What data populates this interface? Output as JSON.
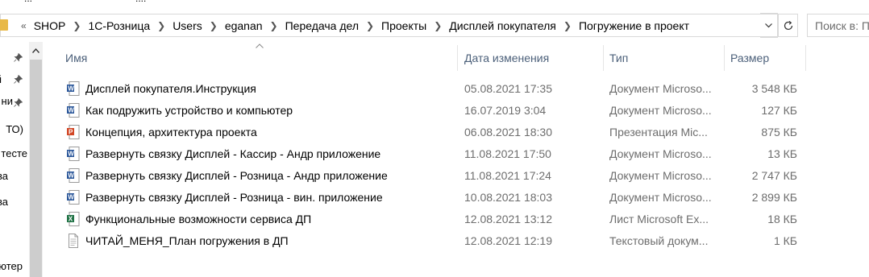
{
  "topstrip": {
    "left_text": "...",
    "right_text": "...."
  },
  "address": {
    "overflow_chevron": "«",
    "crumbs": [
      "SHOP",
      "1С-Розница",
      "Users",
      "eganan",
      "Передача дел",
      "Проекты",
      "Дисплей покупателя",
      "Погружение в проект"
    ],
    "separator": ">"
  },
  "search": {
    "placeholder": "Поиск в: П"
  },
  "nav": {
    "items": [
      {
        "label": "",
        "pinned": true
      },
      {
        "label": "й",
        "pinned": true
      },
      {
        "label": "ни",
        "pinned": true
      },
      {
        "label": "ТО)",
        "pinned": false
      },
      {
        "label": "тесте",
        "pinned": false
      },
      {
        "label": "ва",
        "pinned": false
      },
      {
        "label": "ва",
        "pinned": false
      },
      {
        "label": "",
        "pinned": false
      },
      {
        "label": "",
        "pinned": false
      },
      {
        "label": "ютер",
        "pinned": false
      }
    ]
  },
  "columns": {
    "name": "Имя",
    "date": "Дата изменения",
    "type": "Тип",
    "size": "Размер"
  },
  "files": [
    {
      "icon": "word-doc-icon",
      "name": "Дисплей покупателя.Инструкция",
      "date": "05.08.2021 17:35",
      "type": "Документ Microso...",
      "size": "3 548 КБ"
    },
    {
      "icon": "word-doc-icon",
      "name": "Как подружить устройство и компьютер",
      "date": "16.07.2019 3:04",
      "type": "Документ Microso...",
      "size": "127 КБ"
    },
    {
      "icon": "powerpoint-icon",
      "name": "Концепция, архитектура проекта",
      "date": "06.08.2021 18:30",
      "type": "Презентация Mic...",
      "size": "875 КБ"
    },
    {
      "icon": "word-doc-icon",
      "name": "Развернуть связку Дисплей - Кассир - Андр приложение",
      "date": "11.08.2021 17:50",
      "type": "Документ Microso...",
      "size": "13 КБ"
    },
    {
      "icon": "word-doc-icon",
      "name": "Развернуть связку Дисплей - Розница - Андр приложение",
      "date": "11.08.2021 17:24",
      "type": "Документ Microso...",
      "size": "2 747 КБ"
    },
    {
      "icon": "word-doc-icon",
      "name": "Развернуть связку Дисплей - Розница - вин. приложение",
      "date": "10.08.2021 18:03",
      "type": "Документ Microso...",
      "size": "2 899 КБ"
    },
    {
      "icon": "excel-icon",
      "name": "Функциональные возможности сервиса ДП",
      "date": "12.08.2021 13:12",
      "type": "Лист Microsoft Ex...",
      "size": "18 КБ"
    },
    {
      "icon": "text-file-icon",
      "name": "ЧИТАЙ_МЕНЯ_План погружения в ДП",
      "date": "12.08.2021 12:19",
      "type": "Текстовый докум...",
      "size": "1 КБ"
    }
  ],
  "colors": {
    "header_text": "#4c607a",
    "secondary_text": "#6d6d6d",
    "folder": "#e8b948",
    "word": "#2b579a",
    "powerpoint": "#d24726",
    "excel": "#217346"
  }
}
